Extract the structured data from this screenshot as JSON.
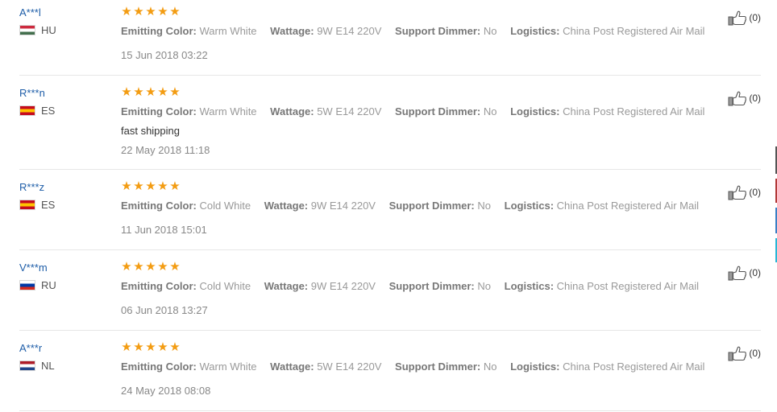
{
  "reviews": [
    {
      "user": "A***l",
      "country": "HU",
      "rating": 5,
      "attrs": [
        {
          "label": "Emitting Color:",
          "value": "Warm White"
        },
        {
          "label": "Wattage:",
          "value": "9W E14 220V"
        },
        {
          "label": "Support Dimmer:",
          "value": "No"
        },
        {
          "label": "Logistics:",
          "value": "China Post Registered Air Mail"
        }
      ],
      "feedback": "",
      "date": "15 Jun 2018 03:22",
      "likes": "(0)"
    },
    {
      "user": "R***n",
      "country": "ES",
      "rating": 5,
      "attrs": [
        {
          "label": "Emitting Color:",
          "value": "Warm White"
        },
        {
          "label": "Wattage:",
          "value": "5W E14 220V"
        },
        {
          "label": "Support Dimmer:",
          "value": "No"
        },
        {
          "label": "Logistics:",
          "value": "China Post Registered Air Mail"
        }
      ],
      "feedback": "fast shipping",
      "date": "22 May 2018 11:18",
      "likes": "(0)"
    },
    {
      "user": "R***z",
      "country": "ES",
      "rating": 5,
      "attrs": [
        {
          "label": "Emitting Color:",
          "value": "Cold White"
        },
        {
          "label": "Wattage:",
          "value": "9W E14 220V"
        },
        {
          "label": "Support Dimmer:",
          "value": "No"
        },
        {
          "label": "Logistics:",
          "value": "China Post Registered Air Mail"
        }
      ],
      "feedback": "",
      "date": "11 Jun 2018 15:01",
      "likes": "(0)"
    },
    {
      "user": "V***m",
      "country": "RU",
      "rating": 5,
      "attrs": [
        {
          "label": "Emitting Color:",
          "value": "Cold White"
        },
        {
          "label": "Wattage:",
          "value": "9W E14 220V"
        },
        {
          "label": "Support Dimmer:",
          "value": "No"
        },
        {
          "label": "Logistics:",
          "value": "China Post Registered Air Mail"
        }
      ],
      "feedback": "",
      "date": "06 Jun 2018 13:27",
      "likes": "(0)"
    },
    {
      "user": "A***r",
      "country": "NL",
      "rating": 5,
      "attrs": [
        {
          "label": "Emitting Color:",
          "value": "Warm White"
        },
        {
          "label": "Wattage:",
          "value": "5W E14 220V"
        },
        {
          "label": "Support Dimmer:",
          "value": "No"
        },
        {
          "label": "Logistics:",
          "value": "China Post Registered Air Mail"
        }
      ],
      "feedback": "",
      "date": "24 May 2018 08:08",
      "likes": "(0)"
    }
  ],
  "colors": {
    "star": "#f39c12",
    "user_link": "#1f5ea8",
    "flags": {
      "HU": [
        "#cd2a3e",
        "#ffffff",
        "#436f4d"
      ],
      "ES": [
        "#c60b1e",
        "#ffc400",
        "#c60b1e"
      ],
      "RU": [
        "#ffffff",
        "#0039a6",
        "#d52b1e"
      ],
      "NL": [
        "#ae1c28",
        "#ffffff",
        "#21468b"
      ]
    }
  },
  "icons": {
    "like": "thumbs-up-icon",
    "star": "star-icon"
  }
}
